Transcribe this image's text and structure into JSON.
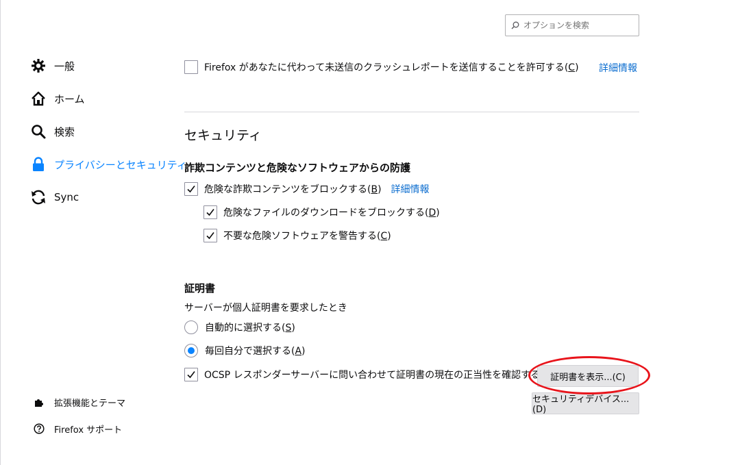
{
  "search": {
    "placeholder": "オプションを検索"
  },
  "sidebar": {
    "items": [
      {
        "label": "一般",
        "icon": "gear-icon"
      },
      {
        "label": "ホーム",
        "icon": "home-icon"
      },
      {
        "label": "検索",
        "icon": "search-icon"
      },
      {
        "label": "プライバシーとセキュリティ",
        "icon": "lock-icon",
        "selected": true
      },
      {
        "label": "Sync",
        "icon": "sync-icon"
      }
    ],
    "footer": [
      {
        "label": "拡張機能とテーマ",
        "icon": "puzzle-icon"
      },
      {
        "label": "Firefox サポート",
        "icon": "help-icon"
      }
    ]
  },
  "crash_report": {
    "label": "Firefox があなたに代わって未送信のクラッシュレポートを送信することを許可する",
    "accesskey": "C",
    "checked": false,
    "learn_more": "詳細情報"
  },
  "security": {
    "heading": "セキュリティ",
    "deceptive": {
      "heading": "詐欺コンテンツと危険なソフトウェアからの防護",
      "block_dangerous": {
        "label": "危険な詐欺コンテンツをブロックする",
        "accesskey": "B",
        "checked": true
      },
      "learn_more": "詳細情報",
      "block_downloads": {
        "label": "危険なファイルのダウンロードをブロックする",
        "accesskey": "D",
        "checked": true
      },
      "warn_unwanted": {
        "label": "不要な危険ソフトウェアを警告する",
        "accesskey": "C",
        "checked": true
      }
    },
    "certificates": {
      "heading": "証明書",
      "prompt": "サーバーが個人証明書を要求したとき",
      "auto_select": {
        "label": "自動的に選択する",
        "accesskey": "S",
        "selected": false
      },
      "ask_every_time": {
        "label": "毎回自分で選択する",
        "accesskey": "A",
        "selected": true
      },
      "ocsp": {
        "label": "OCSP レスポンダーサーバーに問い合わせて証明書の現在の正当性を確認する",
        "accesskey": "Q",
        "checked": true
      },
      "view_certificates_button": "証明書を表示...(C)",
      "security_devices_button": "セキュリティデバイス...(D)"
    }
  },
  "colors": {
    "accent": "#0a84ff",
    "highlight": "#e8141b"
  }
}
